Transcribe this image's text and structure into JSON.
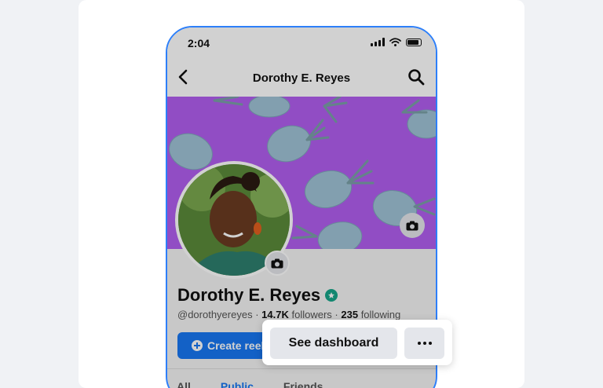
{
  "status_bar": {
    "time": "2:04"
  },
  "navbar": {
    "title": "Dorothy E. Reyes"
  },
  "profile": {
    "name": "Dorothy E. Reyes",
    "handle": "@dorothyereyes",
    "followers_count": "14.7K",
    "followers_label": "followers",
    "following_count": "235",
    "following_label": "following"
  },
  "actions": {
    "create_label": "Create reel"
  },
  "tabs": [
    {
      "label": "All"
    },
    {
      "label": "Public"
    },
    {
      "label": "Friends"
    }
  ],
  "popup": {
    "dashboard_label": "See dashboard"
  },
  "colors": {
    "accent": "#1877f2",
    "phone_border": "#2d7ff9",
    "cover_background": "#b15ff0",
    "verified": "#17a589"
  },
  "icons": [
    "back-icon",
    "search-icon",
    "camera-icon",
    "verified-icon",
    "plus-icon",
    "more-icon",
    "signal-icon",
    "wifi-icon",
    "battery-icon"
  ]
}
